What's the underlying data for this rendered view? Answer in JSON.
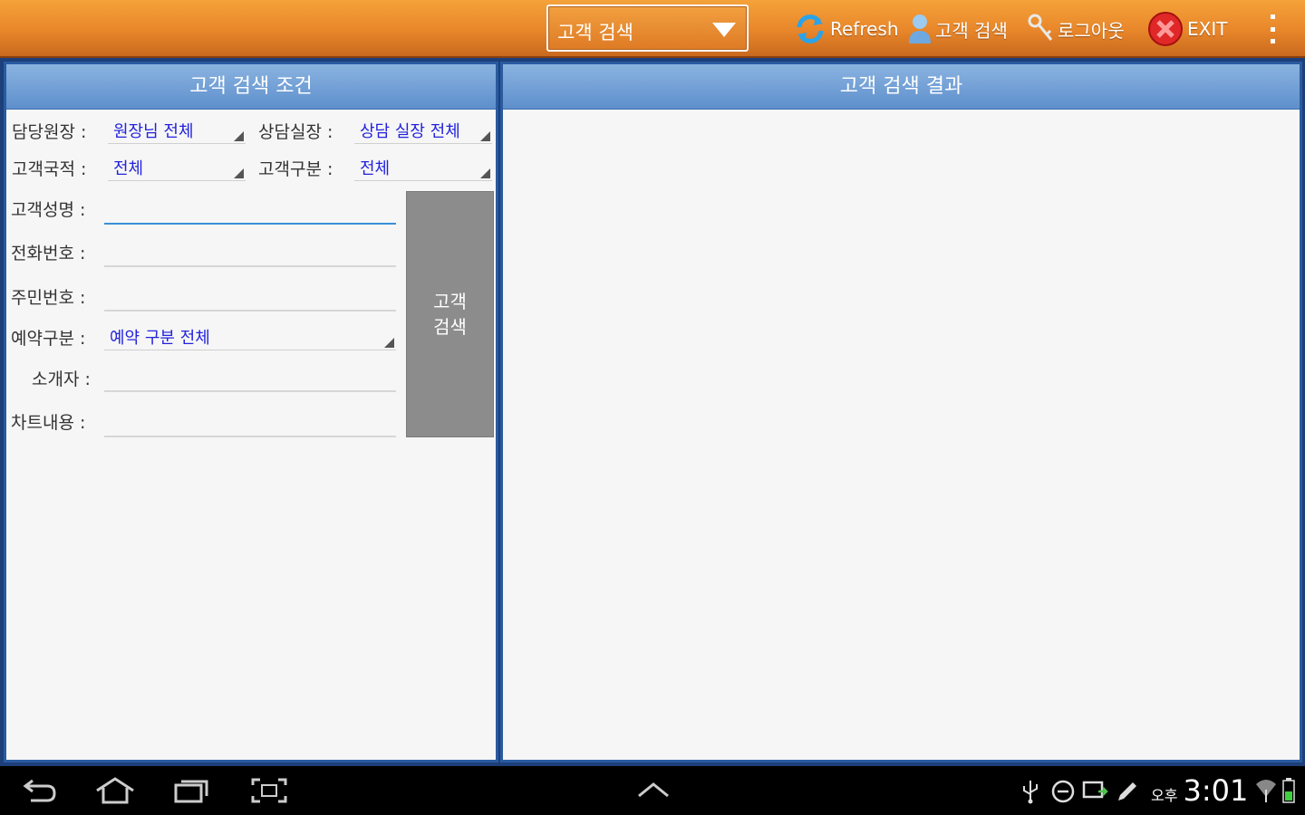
{
  "topbar": {
    "screen_select": {
      "value": "고객 검색"
    },
    "actions": {
      "refresh": "Refresh",
      "customer_search": "고객 검색",
      "logout": "로그아웃",
      "exit": "EXIT"
    }
  },
  "left_panel": {
    "title": "고객 검색 조건",
    "fields": {
      "director_label": "담당원장 :",
      "director_value": "원장님 전체",
      "counselor_label": "상담실장 :",
      "counselor_value": "상담 실장 전체",
      "nationality_label": "고객국적 :",
      "nationality_value": "전체",
      "category_label": "고객구분 :",
      "category_value": "전체",
      "name_label": "고객성명 :",
      "name_value": "",
      "phone_label": "전화번호 :",
      "phone_value": "",
      "resident_label": "주민번호 :",
      "resident_value": "",
      "reservation_label": "예약구분 :",
      "reservation_value": "예약 구분 전체",
      "referrer_label": "소개자 :",
      "referrer_value": "",
      "chart_label": "차트내용 :",
      "chart_value": ""
    },
    "search_button": "고객\n검색"
  },
  "right_panel": {
    "title": "고객 검색 결과"
  },
  "statusbar": {
    "ampm": "오후",
    "time": "3:01"
  },
  "colors": {
    "topbar": "#e8862a",
    "panel_border": "#2a5ba0",
    "panel_header": "#6f9bd4",
    "spinner_value": "#2222dd",
    "search_button": "#8c8c8c"
  }
}
